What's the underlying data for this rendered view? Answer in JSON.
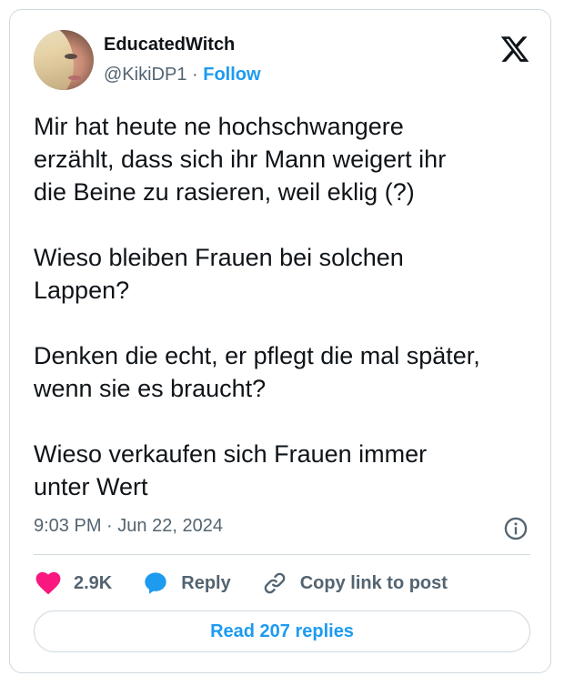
{
  "author": {
    "display_name": "EducatedWitch",
    "handle": "@KikiDP1",
    "separator": "·",
    "follow_label": "Follow"
  },
  "icons": {
    "brand": "x-logo-icon",
    "info": "info-icon",
    "like": "heart-icon",
    "reply": "speech-bubble-icon",
    "copy_link": "link-icon"
  },
  "tweet": {
    "text": "Mir hat heute ne hochschwangere\nerzählt, dass sich ihr Mann weigert ihr\ndie Beine zu rasieren, weil eklig (?)\n\nWieso bleiben Frauen bei solchen\nLappen?\n\nDenken die echt, er pflegt die mal später,\nwenn sie es braucht?\n\nWieso verkaufen sich Frauen immer\nunter Wert",
    "time": "9:03 PM",
    "date": "Jun 22, 2024",
    "meta_separator": "·"
  },
  "actions": {
    "likes_count": "2.9K",
    "reply_label": "Reply",
    "copy_link_label": "Copy link to post"
  },
  "footer": {
    "read_replies_label": "Read 207 replies"
  },
  "colors": {
    "accent": "#1d9bf0",
    "like": "#f91880",
    "muted": "#536471",
    "text": "#0f1419",
    "border": "#cfd9de"
  }
}
